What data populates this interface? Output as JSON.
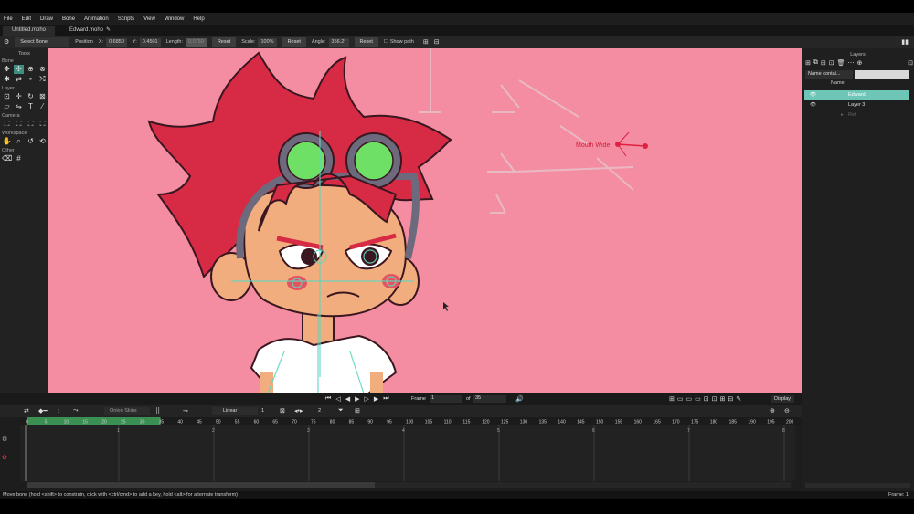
{
  "menu": [
    "File",
    "Edit",
    "Draw",
    "Bone",
    "Animation",
    "Scripts",
    "View",
    "Window",
    "Help"
  ],
  "tabs": [
    "Untitled.moho",
    "Edward.moho"
  ],
  "options": {
    "tool_select": "Select Bone",
    "position_label": "Position",
    "x_label": "X:",
    "x_value": "0.6850",
    "y_label": "Y:",
    "y_value": "0.4501",
    "length_label": "Length:",
    "length_value": "0.0750",
    "reset": "Reset",
    "scale_label": "Scale:",
    "scale_value": "100%",
    "angle_label": "Angle:",
    "angle_value": "356.2°",
    "show_path": "Show path"
  },
  "tools": {
    "title": "Tools",
    "groups": [
      "Bone",
      "Layer",
      "Camera",
      "Workspace",
      "Other"
    ]
  },
  "canvas": {
    "bg_color": "#f48da1",
    "bone_label": "Mouth Wide"
  },
  "layers": {
    "title": "Layers",
    "filter_select": "Name contai...",
    "col_name": "Name",
    "items": [
      {
        "name": "Edward",
        "selected": true
      },
      {
        "name": "Layer 3",
        "selected": false
      },
      {
        "name": "Ref",
        "selected": false
      }
    ]
  },
  "timeline": {
    "frame_label": "Frame",
    "frame_value": "1",
    "of_label": "of",
    "total_frames": "35",
    "display_label": "Display",
    "onion_skins": "Onion Skins",
    "interp": "Linear",
    "interp_val": "1",
    "key_count": "2",
    "ruler_ticks": [
      "0",
      "5",
      "10",
      "15",
      "20",
      "25",
      "30",
      "35",
      "40",
      "45",
      "50",
      "55",
      "60",
      "65",
      "70",
      "75",
      "80",
      "85",
      "90",
      "95",
      "100",
      "105",
      "110",
      "115",
      "120",
      "125",
      "130",
      "135",
      "140",
      "145",
      "150",
      "155",
      "160",
      "165",
      "170",
      "175",
      "180",
      "185",
      "190",
      "195",
      "200"
    ],
    "seconds": [
      "1",
      "2",
      "3",
      "4",
      "5",
      "6",
      "7",
      "8"
    ],
    "playback_range_color": "#3a8f52"
  },
  "status": {
    "hint": "Move bone (hold <shift> to constrain, click with <ctrl/cmd> to add a key, hold <alt> for alternate transform)",
    "frame": "Frame: 1"
  }
}
